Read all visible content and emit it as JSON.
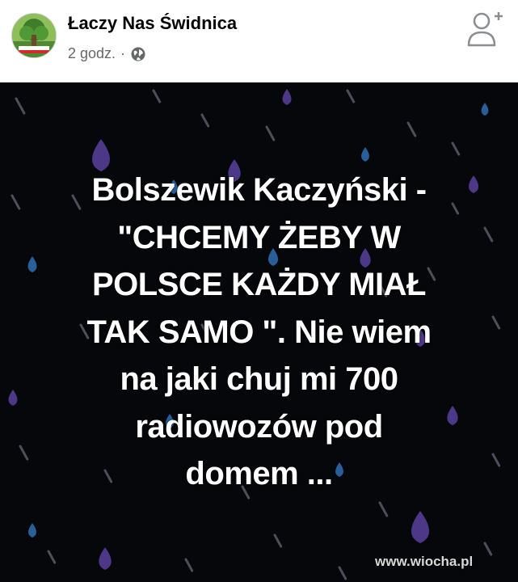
{
  "post": {
    "page_name": "Łaczy Nas Świdnica",
    "time": "2 godz.",
    "separator": "·",
    "privacy_icon": "globe-icon",
    "follow_icon": "add-friend-icon",
    "image_text": "Bolszewik Kaczyński -\n\"CHCEMY ŻEBY W\nPOLSCE KAŻDY MIAŁ\nTAK SAMO \".  Nie wiem\nna jaki chuj mi 700\nradiowozów pod\ndomem ...",
    "watermark": "www.wiocha.pl"
  },
  "colors": {
    "background": "#06070b",
    "drop_purple": "#5b3f9e",
    "drop_blue": "#2f6fb3",
    "drop_grey": "#4a4f5a",
    "text": "#ffffff",
    "meta": "#65676b"
  }
}
